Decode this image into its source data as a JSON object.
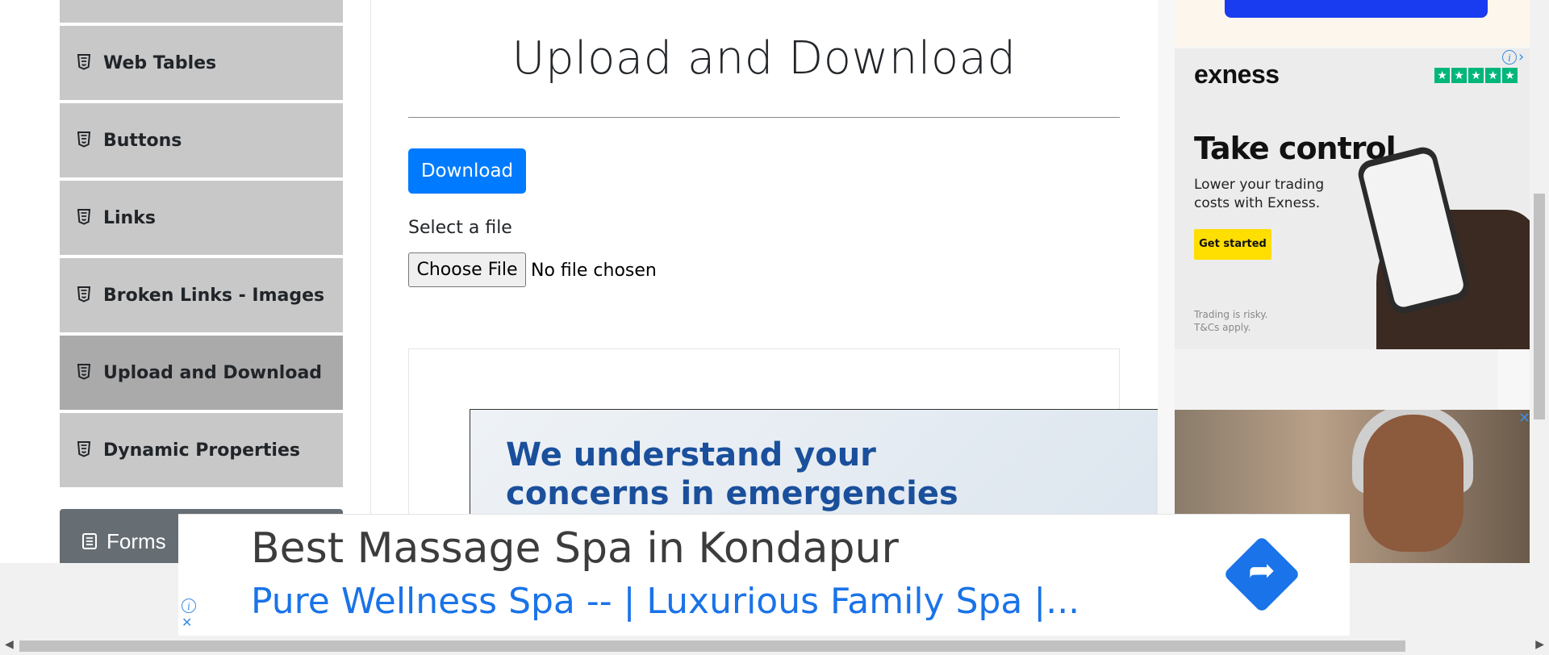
{
  "sidebar": {
    "items": [
      {
        "label": "Web Tables",
        "icon": "html5-icon",
        "active": false
      },
      {
        "label": "Buttons",
        "icon": "html5-icon",
        "active": false
      },
      {
        "label": "Links",
        "icon": "html5-icon",
        "active": false
      },
      {
        "label": "Broken Links - Images",
        "icon": "html5-icon",
        "active": false
      },
      {
        "label": "Upload and Download",
        "icon": "html5-icon",
        "active": true
      },
      {
        "label": "Dynamic Properties",
        "icon": "html5-icon",
        "active": false
      }
    ],
    "group_header": {
      "label": "Forms",
      "icon": "list-icon"
    }
  },
  "main": {
    "title": "Upload and Download",
    "download_label": "Download",
    "select_label": "Select a file",
    "choose_file_label": "Choose File",
    "no_file_text": "No file chosen"
  },
  "ads": {
    "banner_line1": "We understand your",
    "banner_line2": "concerns in emergencies",
    "exness": {
      "brand": "exness",
      "headline": "Take control",
      "sub": "Lower your trading costs with Exness.",
      "cta": "Get started",
      "fine": "Trading is risky. T&Cs apply."
    },
    "bottom": {
      "headline": "Best Massage Spa in Kondapur",
      "subline": "Pure Wellness Spa -- | Luxurious Family Spa |..."
    }
  },
  "colors": {
    "primary": "#007bff",
    "sidebar_bg": "#c8c8c8",
    "sidebar_active": "#aaaaaa",
    "group_header_bg": "#666d73",
    "ad_link": "#1a73e8"
  }
}
